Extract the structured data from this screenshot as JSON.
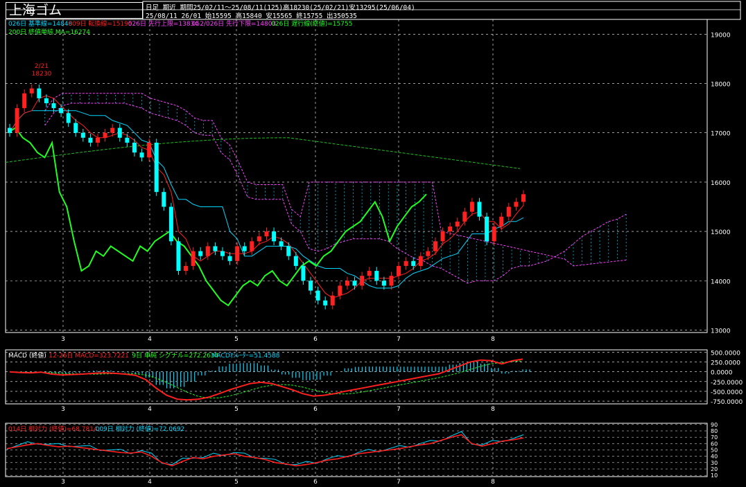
{
  "instrument": "上海ゴム",
  "header": {
    "freq": "日足",
    "contract": "期近",
    "period_line": "期間25/02/11〜25/08/11(125)高18230(25/02/21)安13295(25/06/04)",
    "date_line": "25/08/11 26/01 始15595 高15840 安15565 終15755 出350535"
  },
  "legend_main": [
    {
      "text": "026日 基準線=14848",
      "color": "#00d8ff"
    },
    {
      "text": "009日 転換線=15195",
      "color": "#ff2020"
    },
    {
      "text": "026日 先行上限=13834",
      "color": "#ff40ff"
    },
    {
      "text": "052/026日 先行下限=14803",
      "color": "#ff40ff"
    },
    {
      "text": "026日 遅行線(終値)=15755",
      "color": "#20ff20"
    }
  ],
  "legend_main2": [
    {
      "text": "200日 終値単純 MA=16274",
      "color": "#20ff20"
    }
  ],
  "annotation_high": {
    "date": "2/21",
    "value": "18230"
  },
  "legend_macd": [
    {
      "text": "MACD (終値)",
      "color": "#ffffff"
    },
    {
      "text": "12-26日 MACD=323.7221",
      "color": "#ff2020"
    },
    {
      "text": "9日 単純 シグナル=272.2634",
      "color": "#20ff20"
    },
    {
      "text": "MACDｵｼﾚｰﾀｰ=51.4588",
      "color": "#00d8ff"
    }
  ],
  "legend_rsi": [
    {
      "text": "014日 相対力 (終値)=68.7814",
      "color": "#ff2020"
    },
    {
      "text": "009日 相対力 (終値)=72.0692",
      "color": "#00d8ff"
    }
  ],
  "x_month_labels": [
    "3",
    "4",
    "5",
    "6",
    "7",
    "8"
  ],
  "colors": {
    "up": "#ff2020",
    "down": "#00ffff",
    "kumo": "#00d8ff",
    "senkou": "#ff40ff",
    "chikou": "#20ff20",
    "ma": "#20c020"
  },
  "chart_data": [
    {
      "type": "candlestick",
      "name": "price",
      "y_ticks": [
        13000,
        14000,
        15000,
        16000,
        17000,
        18000,
        19000
      ],
      "ylim": [
        12950,
        19300
      ],
      "x_ticks": [
        "3",
        "4",
        "5",
        "6",
        "7",
        "8"
      ],
      "ohlc_checkpoints": {
        "description_days": "approx daily closes across 125 sessions",
        "close": [
          17000,
          17500,
          17800,
          17900,
          17700,
          17600,
          17500,
          17400,
          17200,
          17000,
          16900,
          16800,
          16900,
          17000,
          17100,
          16900,
          16800,
          16600,
          16500,
          16800,
          15800,
          15500,
          14800,
          14200,
          14300,
          14600,
          14500,
          14700,
          14600,
          14500,
          14400,
          14700,
          14600,
          14800,
          14900,
          15000,
          14800,
          14700,
          14500,
          14300,
          14000,
          13800,
          13600,
          13500,
          13700,
          13900,
          14000,
          13900,
          14100,
          14200,
          14000,
          13900,
          14100,
          14300,
          14400,
          14300,
          14500,
          14600,
          14800,
          15000,
          15100,
          15200,
          15400,
          15600,
          15300,
          14800,
          15100,
          15300,
          15500,
          15600,
          15755
        ],
        "high_marker": 18230,
        "low_marker": 13295
      },
      "ma200": {
        "start": 16400,
        "peak": 16900,
        "end": 16274
      },
      "kijun_last": 14848,
      "tenkan_last": 15195,
      "senkou_a_last": 13834,
      "senkou_b_last": 14803,
      "chikou_last": 15755
    },
    {
      "type": "line",
      "name": "macd",
      "y_ticks": [
        500,
        250,
        0,
        -250,
        -500,
        -750
      ],
      "ylim": [
        -820,
        560
      ],
      "macd_last": 323.7221,
      "signal_last": 272.2634,
      "osc_last": 51.4588
    },
    {
      "type": "line",
      "name": "rsi",
      "y_ticks": [
        90,
        80,
        70,
        60,
        50,
        40,
        30,
        20,
        10
      ],
      "ylim": [
        8,
        92
      ],
      "rsi14_last": 68.7814,
      "rsi9_last": 72.0692
    }
  ]
}
